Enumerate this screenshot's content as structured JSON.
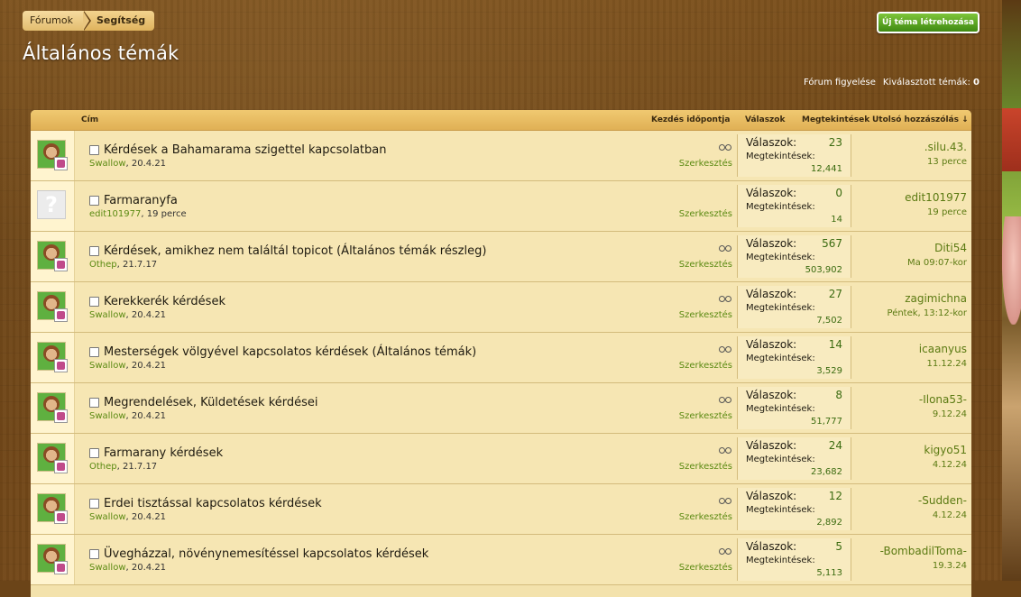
{
  "breadcrumb": {
    "first": "Fórumok",
    "second": "Segítség"
  },
  "page_title": "Általános témák",
  "new_topic_button": "Új téma létrehozása",
  "top_links": {
    "watch": "Fórum figyelése",
    "selected_label": "Kiválasztott témák:",
    "selected_count": "0"
  },
  "columns": {
    "title": "Cím",
    "start_date": "Kezdés időpontja",
    "replies": "Válaszok",
    "views": "Megtekintések",
    "last_post": "Utolsó hozzászólás ↓"
  },
  "labels": {
    "replies": "Válaszok:",
    "views": "Megtekintések:",
    "edit": "Szerkesztés"
  },
  "topics": [
    {
      "title": "Kérdések a Bahamarama szigettel kapcsolatban",
      "author": "Swallow",
      "date": "20.4.21",
      "replies": "23",
      "views": "12,441",
      "last_user": ".silu.43.",
      "last_time": "13 perce",
      "avatar": "farmer",
      "glasses": true
    },
    {
      "title": "Farmaranyfa",
      "author": "edit101977",
      "date": "19 perce",
      "replies": "0",
      "views": "14",
      "last_user": "edit101977",
      "last_time": "19 perce",
      "avatar": "placeholder",
      "glasses": false
    },
    {
      "title": "Kérdések, amikhez nem találtál topicot (Általános témák részleg)",
      "author": "Othep",
      "date": "21.7.17",
      "replies": "567",
      "views": "503,902",
      "last_user": "Diti54",
      "last_time": "Ma 09:07-kor",
      "avatar": "farmer",
      "glasses": true
    },
    {
      "title": "Kerekkerék kérdések",
      "author": "Swallow",
      "date": "20.4.21",
      "replies": "27",
      "views": "7,502",
      "last_user": "zagimichna",
      "last_time": "Péntek, 13:12-kor",
      "avatar": "farmer",
      "glasses": true
    },
    {
      "title": "Mesterségek völgyével kapcsolatos kérdések (Általános témák)",
      "author": "Swallow",
      "date": "20.4.21",
      "replies": "14",
      "views": "3,529",
      "last_user": "icaanyus",
      "last_time": "11.12.24",
      "avatar": "farmer",
      "glasses": true
    },
    {
      "title": "Megrendelések, Küldetések kérdései",
      "author": "Swallow",
      "date": "20.4.21",
      "replies": "8",
      "views": "51,777",
      "last_user": "-Ilona53-",
      "last_time": "9.12.24",
      "avatar": "farmer",
      "glasses": true
    },
    {
      "title": "Farmarany kérdések",
      "author": "Othep",
      "date": "21.7.17",
      "replies": "24",
      "views": "23,682",
      "last_user": "kigyo51",
      "last_time": "4.12.24",
      "avatar": "farmer",
      "glasses": true
    },
    {
      "title": "Erdei tisztással kapcsolatos kérdések",
      "author": "Swallow",
      "date": "20.4.21",
      "replies": "12",
      "views": "2,892",
      "last_user": "-Sudden-",
      "last_time": "4.12.24",
      "avatar": "farmer",
      "glasses": true
    },
    {
      "title": "Üvegházzal, növénynemesítéssel kapcsolatos kérdések",
      "author": "Swallow",
      "date": "20.4.21",
      "replies": "5",
      "views": "5,113",
      "last_user": "-BombadilToma-",
      "last_time": "19.3.24",
      "avatar": "farmer",
      "glasses": true
    }
  ]
}
